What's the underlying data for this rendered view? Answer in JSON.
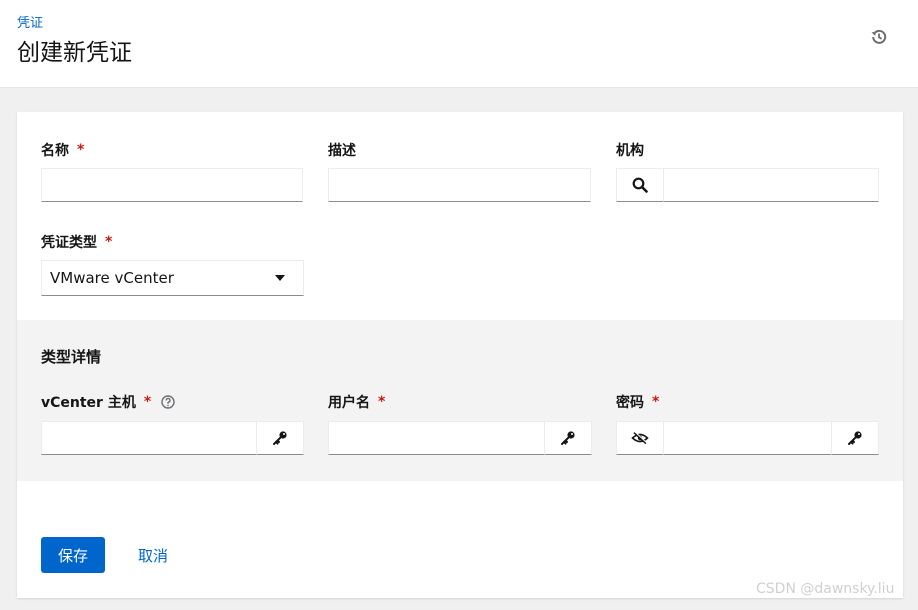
{
  "header": {
    "breadcrumb": "凭证",
    "title": "创建新凭证",
    "history_icon": "history-icon"
  },
  "form": {
    "name": {
      "label": "名称",
      "required_mark": "*",
      "value": ""
    },
    "description": {
      "label": "描述",
      "value": ""
    },
    "organization": {
      "label": "机构",
      "value": "",
      "search_icon": "search-icon"
    },
    "credential_type": {
      "label": "凭证类型",
      "required_mark": "*",
      "value": "VMware vCenter"
    }
  },
  "type_details": {
    "title": "类型详情",
    "vcenter_host": {
      "label": "vCenter 主机",
      "required_mark": "*",
      "value": "",
      "help_icon": "question-circle-icon",
      "key_icon": "key-icon"
    },
    "username": {
      "label": "用户名",
      "required_mark": "*",
      "value": "",
      "key_icon": "key-icon"
    },
    "password": {
      "label": "密码",
      "required_mark": "*",
      "value": "",
      "toggle_icon": "eye-slash-icon",
      "key_icon": "key-icon"
    }
  },
  "actions": {
    "save_label": "保存",
    "cancel_label": "取消"
  },
  "watermark": "CSDN @dawnsky.liu",
  "colors": {
    "primary": "#0066cc",
    "required": "#c9190b",
    "background": "#f0f0f0",
    "details_bg": "#f3f3f3"
  }
}
